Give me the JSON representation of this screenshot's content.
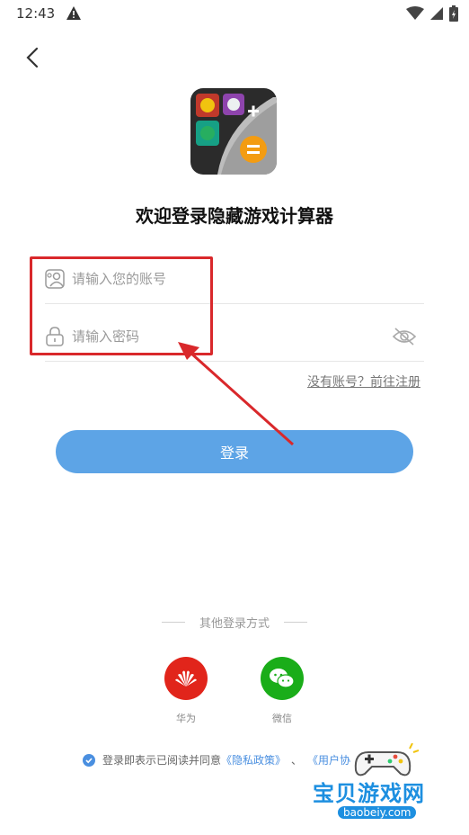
{
  "status_bar": {
    "time": "12:43"
  },
  "title": "欢迎登录隐藏游戏计算器",
  "account": {
    "placeholder": "请输入您的账号",
    "value": ""
  },
  "password": {
    "placeholder": "请输入密码",
    "value": ""
  },
  "register_link": "没有账号？前往注册",
  "login_button": "登录",
  "other_login": {
    "label": "其他登录方式",
    "options": [
      {
        "label": "华为",
        "color": "#e1251b"
      },
      {
        "label": "微信",
        "color": "#1aad19"
      }
    ]
  },
  "agreement": {
    "prefix": "登录即表示已阅读并同意",
    "privacy": "《隐私政策》",
    "separator": "、",
    "user": "《用户协"
  },
  "watermark": {
    "title": "宝贝游戏网",
    "url": "baobeiy.com"
  },
  "colors": {
    "primary": "#5da4e6",
    "highlight": "#d9282b",
    "link": "#4a8fe0"
  }
}
